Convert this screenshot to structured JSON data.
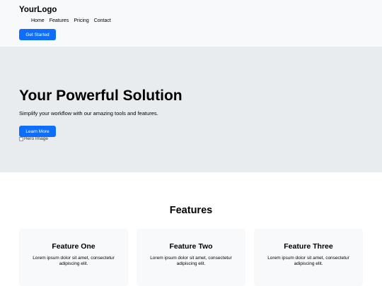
{
  "header": {
    "logo": "YourLogo",
    "nav": [
      "Home",
      "Features",
      "Pricing",
      "Contact"
    ],
    "cta_label": "Get Started"
  },
  "hero": {
    "title": "Your Powerful Solution",
    "subtitle": "Simplify your workflow with our amazing tools and features.",
    "button_label": "Learn More",
    "image_alt": "Hero Image"
  },
  "features": {
    "title": "Features",
    "items": [
      {
        "title": "Feature One",
        "text": "Lorem ipsum dolor sit amet, consectetur adipiscing elit."
      },
      {
        "title": "Feature Two",
        "text": "Lorem ipsum dolor sit amet, consectetur adipiscing elit."
      },
      {
        "title": "Feature Three",
        "text": "Lorem ipsum dolor sit amet, consectetur adipiscing elit."
      }
    ]
  },
  "colors": {
    "primary": "#0d6efd",
    "header_bg": "#f8f9fa",
    "hero_bg": "#e9ecef",
    "card_bg": "#f8f9fa"
  }
}
